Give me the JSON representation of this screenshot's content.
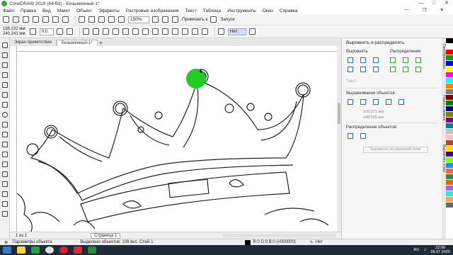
{
  "window": {
    "title": "CorelDRAW 2019 (64-Bit) - Безымянный-1*"
  },
  "menu": [
    "Файл",
    "Правка",
    "Вид",
    "Макет",
    "Объект",
    "Эффекты",
    "Растровые изображения",
    "Текст",
    "Таблица",
    "Инструменты",
    "Окно",
    "Справка"
  ],
  "toolbar": {
    "zoom": "150%",
    "snap_label": "Привязать к",
    "launch_label": "Запуск"
  },
  "props": {
    "x": "198,232 мм",
    "y": "240,241 мм",
    "angle": "0,0",
    "outline": "Нет"
  },
  "tabs": {
    "welcome": "Экран приветствия",
    "doc": "Безымянный-1*"
  },
  "docker": {
    "title": "Выровнять и распределить",
    "align_head": "Выровнять",
    "distribute_head": "Распределение",
    "text_label": "Текст",
    "align_objects_head": "Выравнивание объектов:",
    "field_x": "105,071 мм",
    "field_y": "148,505 мм",
    "distribute_objects_head": "Распределение объектов:",
    "button": "Выровнять по указанной сетке",
    "side_tabs": [
      "Преобразовать",
      "Поиск и замена",
      "Выровнять и рас."
    ]
  },
  "pagebar": {
    "counter": "1 из 1",
    "page_tab": "Страница 1"
  },
  "status": {
    "params": "Параметры объекта",
    "selection": "Выделено объектов: 108 вкл. Слой 1",
    "fill": "R:0 G:0 B:0 (#000000)",
    "outline": "Нет"
  },
  "tray": {
    "lang": "RU",
    "time": "22:06",
    "date": "05.07.2020"
  },
  "colors": {
    "accent_green": "#22cc22",
    "palette": [
      "#000000",
      "#ffffff",
      "#ff0000",
      "#00a000",
      "#0000ff",
      "#ffff00",
      "#ff00ff",
      "#00ffff",
      "#ff8000",
      "#808080",
      "#800000",
      "#008000",
      "#000080",
      "#808000",
      "#800080",
      "#008080",
      "#c0c0c0",
      "#ffc0cb",
      "#a0522d",
      "#ffd700",
      "#4b0082",
      "#7fff00",
      "#1e90ff",
      "#ff6347",
      "#2e8b57",
      "#d2691e",
      "#9370db",
      "#40e0d0",
      "#f4a460",
      "#696969"
    ]
  }
}
